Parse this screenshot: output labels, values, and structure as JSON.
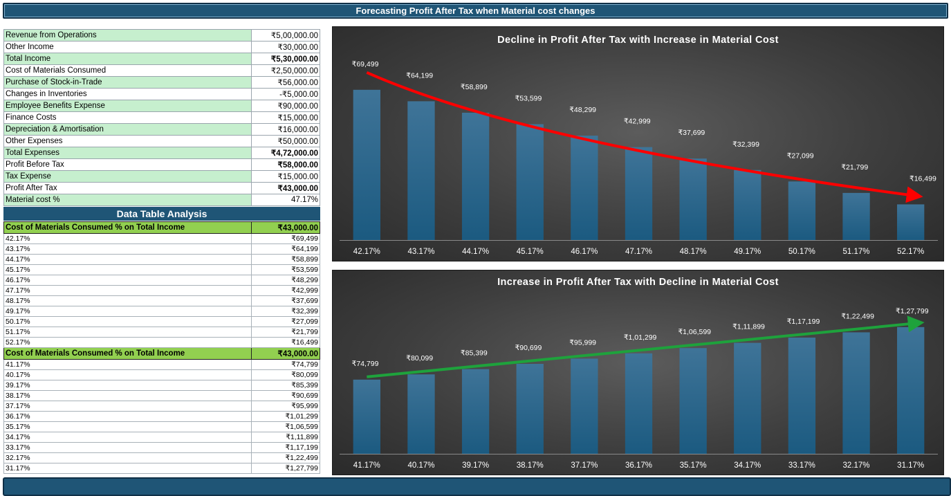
{
  "header": {
    "title": "Forecasting Profit After Tax when Material cost changes"
  },
  "inputs": [
    {
      "label": "Revenue from Operations",
      "value": "₹5,00,000.00",
      "green": true,
      "bold": false
    },
    {
      "label": "Other Income",
      "value": "₹30,000.00",
      "green": false,
      "bold": false
    },
    {
      "label": "Total Income",
      "value": "₹5,30,000.00",
      "green": true,
      "bold": true
    },
    {
      "label": "Cost of Materials Consumed",
      "value": "₹2,50,000.00",
      "green": false,
      "bold": false
    },
    {
      "label": "Purchase of Stock-in-Trade",
      "value": "₹56,000.00",
      "green": true,
      "bold": false
    },
    {
      "label": "Changes in Inventories",
      "value": "-₹5,000.00",
      "green": false,
      "bold": false
    },
    {
      "label": "Employee Benefits Expense",
      "value": "₹90,000.00",
      "green": true,
      "bold": false
    },
    {
      "label": "Finance Costs",
      "value": "₹15,000.00",
      "green": false,
      "bold": false
    },
    {
      "label": "Depreciation & Amortisation",
      "value": "₹16,000.00",
      "green": true,
      "bold": false
    },
    {
      "label": "Other Expenses",
      "value": "₹50,000.00",
      "green": false,
      "bold": false
    },
    {
      "label": "Total Expenses",
      "value": "₹4,72,000.00",
      "green": true,
      "bold": true
    },
    {
      "label": "Profit Before Tax",
      "value": "₹58,000.00",
      "green": false,
      "bold": true
    },
    {
      "label": "Tax Expense",
      "value": "₹15,000.00",
      "green": true,
      "bold": false
    },
    {
      "label": "Profit After Tax",
      "value": "₹43,000.00",
      "green": false,
      "bold": true
    },
    {
      "label": "Material cost %",
      "value": "47.17%",
      "green": true,
      "bold": false
    }
  ],
  "data_table": {
    "title": "Data Table Analysis",
    "sections": [
      {
        "header_label": "Cost of Materials Consumed % on Total Income",
        "header_value": "₹43,000.00",
        "rows": [
          [
            "42.17%",
            "₹69,499"
          ],
          [
            "43.17%",
            "₹64,199"
          ],
          [
            "44.17%",
            "₹58,899"
          ],
          [
            "45.17%",
            "₹53,599"
          ],
          [
            "46.17%",
            "₹48,299"
          ],
          [
            "47.17%",
            "₹42,999"
          ],
          [
            "48.17%",
            "₹37,699"
          ],
          [
            "49.17%",
            "₹32,399"
          ],
          [
            "50.17%",
            "₹27,099"
          ],
          [
            "51.17%",
            "₹21,799"
          ],
          [
            "52.17%",
            "₹16,499"
          ]
        ]
      },
      {
        "header_label": "Cost of Materials Consumed % on Total Income",
        "header_value": "₹43,000.00",
        "rows": [
          [
            "41.17%",
            "₹74,799"
          ],
          [
            "40.17%",
            "₹80,099"
          ],
          [
            "39.17%",
            "₹85,399"
          ],
          [
            "38.17%",
            "₹90,699"
          ],
          [
            "37.17%",
            "₹95,999"
          ],
          [
            "36.17%",
            "₹1,01,299"
          ],
          [
            "35.17%",
            "₹1,06,599"
          ],
          [
            "34.17%",
            "₹1,11,899"
          ],
          [
            "33.17%",
            "₹1,17,199"
          ],
          [
            "32.17%",
            "₹1,22,499"
          ],
          [
            "31.17%",
            "₹1,27,799"
          ]
        ]
      }
    ]
  },
  "colors": {
    "header_bg": "#1f5576",
    "green_row": "#c6efce",
    "dt_header": "#92d050",
    "bar": "#1b5a80",
    "down_arrow": "#ff0000",
    "up_arrow": "#1ea23c"
  },
  "chart_data": [
    {
      "type": "bar",
      "title": "Decline in Profit After Tax with Increase in Material Cost",
      "categories": [
        "42.17%",
        "43.17%",
        "44.17%",
        "45.17%",
        "46.17%",
        "47.17%",
        "48.17%",
        "49.17%",
        "50.17%",
        "51.17%",
        "52.17%"
      ],
      "values": [
        69499,
        64199,
        58899,
        53599,
        48299,
        42999,
        37699,
        32399,
        27099,
        21799,
        16499
      ],
      "labels": [
        "₹69,499",
        "₹64,199",
        "₹58,899",
        "₹53,599",
        "₹48,299",
        "₹42,999",
        "₹37,699",
        "₹32,399",
        "₹27,099",
        "₹21,799",
        "₹16,499"
      ],
      "trend_arrow": "down",
      "ylim": [
        0,
        80000
      ]
    },
    {
      "type": "bar",
      "title": "Increase in Profit After Tax with Decline in Material Cost",
      "categories": [
        "41.17%",
        "40.17%",
        "39.17%",
        "38.17%",
        "37.17%",
        "36.17%",
        "35.17%",
        "34.17%",
        "33.17%",
        "32.17%",
        "31.17%"
      ],
      "values": [
        74799,
        80099,
        85399,
        90699,
        95999,
        101299,
        106599,
        111899,
        117199,
        122499,
        127799
      ],
      "labels": [
        "₹74,799",
        "₹80,099",
        "₹85,399",
        "₹90,699",
        "₹95,999",
        "₹1,01,299",
        "₹1,06,599",
        "₹1,11,899",
        "₹1,17,199",
        "₹1,22,499",
        "₹1,27,799"
      ],
      "trend_arrow": "up",
      "ylim": [
        0,
        150000
      ]
    }
  ]
}
